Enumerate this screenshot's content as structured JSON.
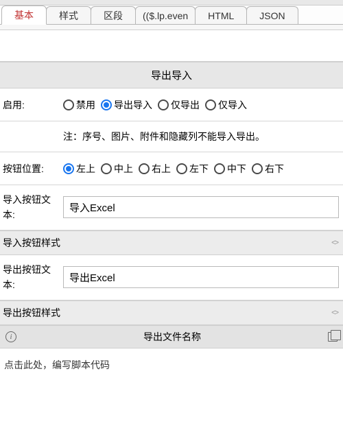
{
  "tabs": {
    "basic": "基本",
    "style": "样式",
    "section": "区段",
    "expr": "(($.lp.even",
    "html": "HTML",
    "json": "JSON"
  },
  "section_title": "导出导入",
  "enable": {
    "label": "启用:",
    "options": {
      "disable": "禁用",
      "both": "导出导入",
      "export_only": "仅导出",
      "import_only": "仅导入"
    },
    "selected": "both"
  },
  "note": "注：序号、图片、附件和隐藏列不能导入导出。",
  "position": {
    "label": "按钮位置:",
    "options": {
      "tl": "左上",
      "tc": "中上",
      "tr": "右上",
      "bl": "左下",
      "bc": "中下",
      "br": "右下"
    },
    "selected": "tl"
  },
  "import_button": {
    "label_a": "导入按钮文",
    "label_b": "本:",
    "value": "导入Excel"
  },
  "import_style_label": "导入按钮样式",
  "export_button": {
    "label_a": "导出按钮文",
    "label_b": "本:",
    "value": "导出Excel"
  },
  "export_style_label": "导出按钮样式",
  "script": {
    "title": "导出文件名称",
    "placeholder": "点击此处，编写脚本代码"
  }
}
